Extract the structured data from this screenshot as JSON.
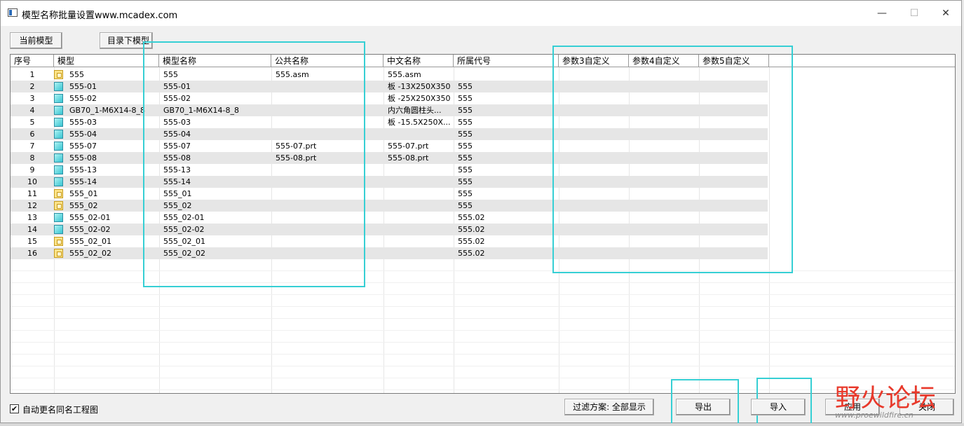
{
  "window": {
    "title": "模型名称批量设置www.mcadex.com",
    "controls": {
      "minimize": "—",
      "maximize": "☐",
      "close": "✕"
    }
  },
  "toolbar": {
    "current_model_label": "当前模型",
    "dir_model_label": "目录下模型"
  },
  "columns": [
    "序号",
    "模型",
    "模型名称",
    "公共名称",
    "中文名称",
    "所属代号",
    "参数3自定义",
    "参数4自定义",
    "参数5自定义"
  ],
  "rows": [
    {
      "num": "1",
      "icon": "asm",
      "model": "555",
      "name": "555",
      "common": "555.asm",
      "cn": "555.asm",
      "code": ""
    },
    {
      "num": "2",
      "icon": "part",
      "model": "555-01",
      "name": "555-01",
      "common": "",
      "cn": "板 -13X250X350",
      "code": "555"
    },
    {
      "num": "3",
      "icon": "part",
      "model": "555-02",
      "name": "555-02",
      "common": "",
      "cn": "板 -25X250X350",
      "code": "555"
    },
    {
      "num": "4",
      "icon": "part",
      "model": "GB70_1-M6X14-8_8",
      "name": "GB70_1-M6X14-8_8",
      "common": "",
      "cn": "内六角圆柱头...",
      "code": "555"
    },
    {
      "num": "5",
      "icon": "part",
      "model": "555-03",
      "name": "555-03",
      "common": "",
      "cn": "板 -15.5X250X...",
      "code": "555"
    },
    {
      "num": "6",
      "icon": "part",
      "model": "555-04",
      "name": "555-04",
      "common": "",
      "cn": "",
      "code": "555"
    },
    {
      "num": "7",
      "icon": "part",
      "model": "555-07",
      "name": "555-07",
      "common": "555-07.prt",
      "cn": "555-07.prt",
      "code": "555"
    },
    {
      "num": "8",
      "icon": "part",
      "model": "555-08",
      "name": "555-08",
      "common": "555-08.prt",
      "cn": "555-08.prt",
      "code": "555"
    },
    {
      "num": "9",
      "icon": "part",
      "model": "555-13",
      "name": "555-13",
      "common": "",
      "cn": "",
      "code": "555"
    },
    {
      "num": "10",
      "icon": "part",
      "model": "555-14",
      "name": "555-14",
      "common": "",
      "cn": "",
      "code": "555"
    },
    {
      "num": "11",
      "icon": "asm",
      "model": "555_01",
      "name": "555_01",
      "common": "",
      "cn": "",
      "code": "555"
    },
    {
      "num": "12",
      "icon": "asm",
      "model": "555_02",
      "name": "555_02",
      "common": "",
      "cn": "",
      "code": "555"
    },
    {
      "num": "13",
      "icon": "part",
      "model": "555_02-01",
      "name": "555_02-01",
      "common": "",
      "cn": "",
      "code": "555.02"
    },
    {
      "num": "14",
      "icon": "part",
      "model": "555_02-02",
      "name": "555_02-02",
      "common": "",
      "cn": "",
      "code": "555.02"
    },
    {
      "num": "15",
      "icon": "asm",
      "model": "555_02_01",
      "name": "555_02_01",
      "common": "",
      "cn": "",
      "code": "555.02"
    },
    {
      "num": "16",
      "icon": "asm",
      "model": "555_02_02",
      "name": "555_02_02",
      "common": "",
      "cn": "",
      "code": "555.02"
    }
  ],
  "footer": {
    "auto_rename_checked": true,
    "auto_rename_label": "自动更名同名工程图",
    "check_mark": "✔",
    "filter_label": "过滤方案: 全部显示",
    "export_label": "导出",
    "import_label": "导入",
    "apply_label": "应用",
    "close_label": "关闭"
  },
  "watermark": {
    "text": "野火论坛",
    "url": "www.proewildfire.cn"
  },
  "colors": {
    "highlight": "#36cfd4",
    "row_alt": "#e6e6e6",
    "watermark": "#e8392b"
  }
}
